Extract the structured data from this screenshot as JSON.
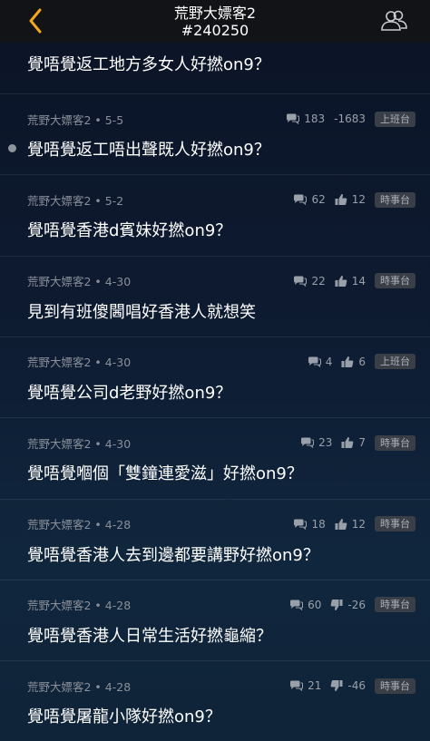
{
  "header": {
    "title": "荒野大嫖客2",
    "subtitle": "#240250",
    "back_icon": "chevron-left-icon",
    "members_icon": "users-icon",
    "accent": "#f0a81c"
  },
  "first_post": {
    "title": "覺唔覺返工地方多女人好撚on9？"
  },
  "posts": [
    {
      "author": "荒野大嫖客2 • 5-5",
      "comments": "183",
      "score": "-1683",
      "vote_icon": "comment-icon",
      "score_icon": "none",
      "tag": "上班台",
      "title": "覺唔覺返工唔出聲既人好撚on9？",
      "unread": true
    },
    {
      "author": "荒野大嫖客2 • 5-2",
      "comments": "62",
      "score": "12",
      "score_icon": "thumbs-up-icon",
      "tag": "時事台",
      "title": "覺唔覺香港d賓妹好撚on9？",
      "unread": false
    },
    {
      "author": "荒野大嫖客2 • 4-30",
      "comments": "22",
      "score": "14",
      "score_icon": "thumbs-up-icon",
      "tag": "時事台",
      "title": "見到有班傻閪唱好香港人就想笑",
      "unread": false
    },
    {
      "author": "荒野大嫖客2 • 4-30",
      "comments": "4",
      "score": "6",
      "score_icon": "thumbs-up-icon",
      "tag": "上班台",
      "title": "覺唔覺公司d老野好撚on9？",
      "unread": false
    },
    {
      "author": "荒野大嫖客2 • 4-30",
      "comments": "23",
      "score": "7",
      "score_icon": "thumbs-up-icon",
      "tag": "時事台",
      "title": "覺唔覺嗰個「雙鐘連愛滋」好撚on9？",
      "unread": false
    },
    {
      "author": "荒野大嫖客2 • 4-28",
      "comments": "18",
      "score": "12",
      "score_icon": "thumbs-up-icon",
      "tag": "時事台",
      "title": "覺唔覺香港人去到邊都要講野好撚on9？",
      "unread": false
    },
    {
      "author": "荒野大嫖客2 • 4-28",
      "comments": "60",
      "score": "-26",
      "score_icon": "thumbs-down-icon",
      "tag": "時事台",
      "title": "覺唔覺香港人日常生活好撚龜縮？",
      "unread": false
    },
    {
      "author": "荒野大嫖客2 • 4-28",
      "comments": "21",
      "score": "-46",
      "score_icon": "thumbs-down-icon",
      "tag": "時事台",
      "title": "覺唔覺屠龍小隊好撚on9？",
      "unread": false
    }
  ]
}
